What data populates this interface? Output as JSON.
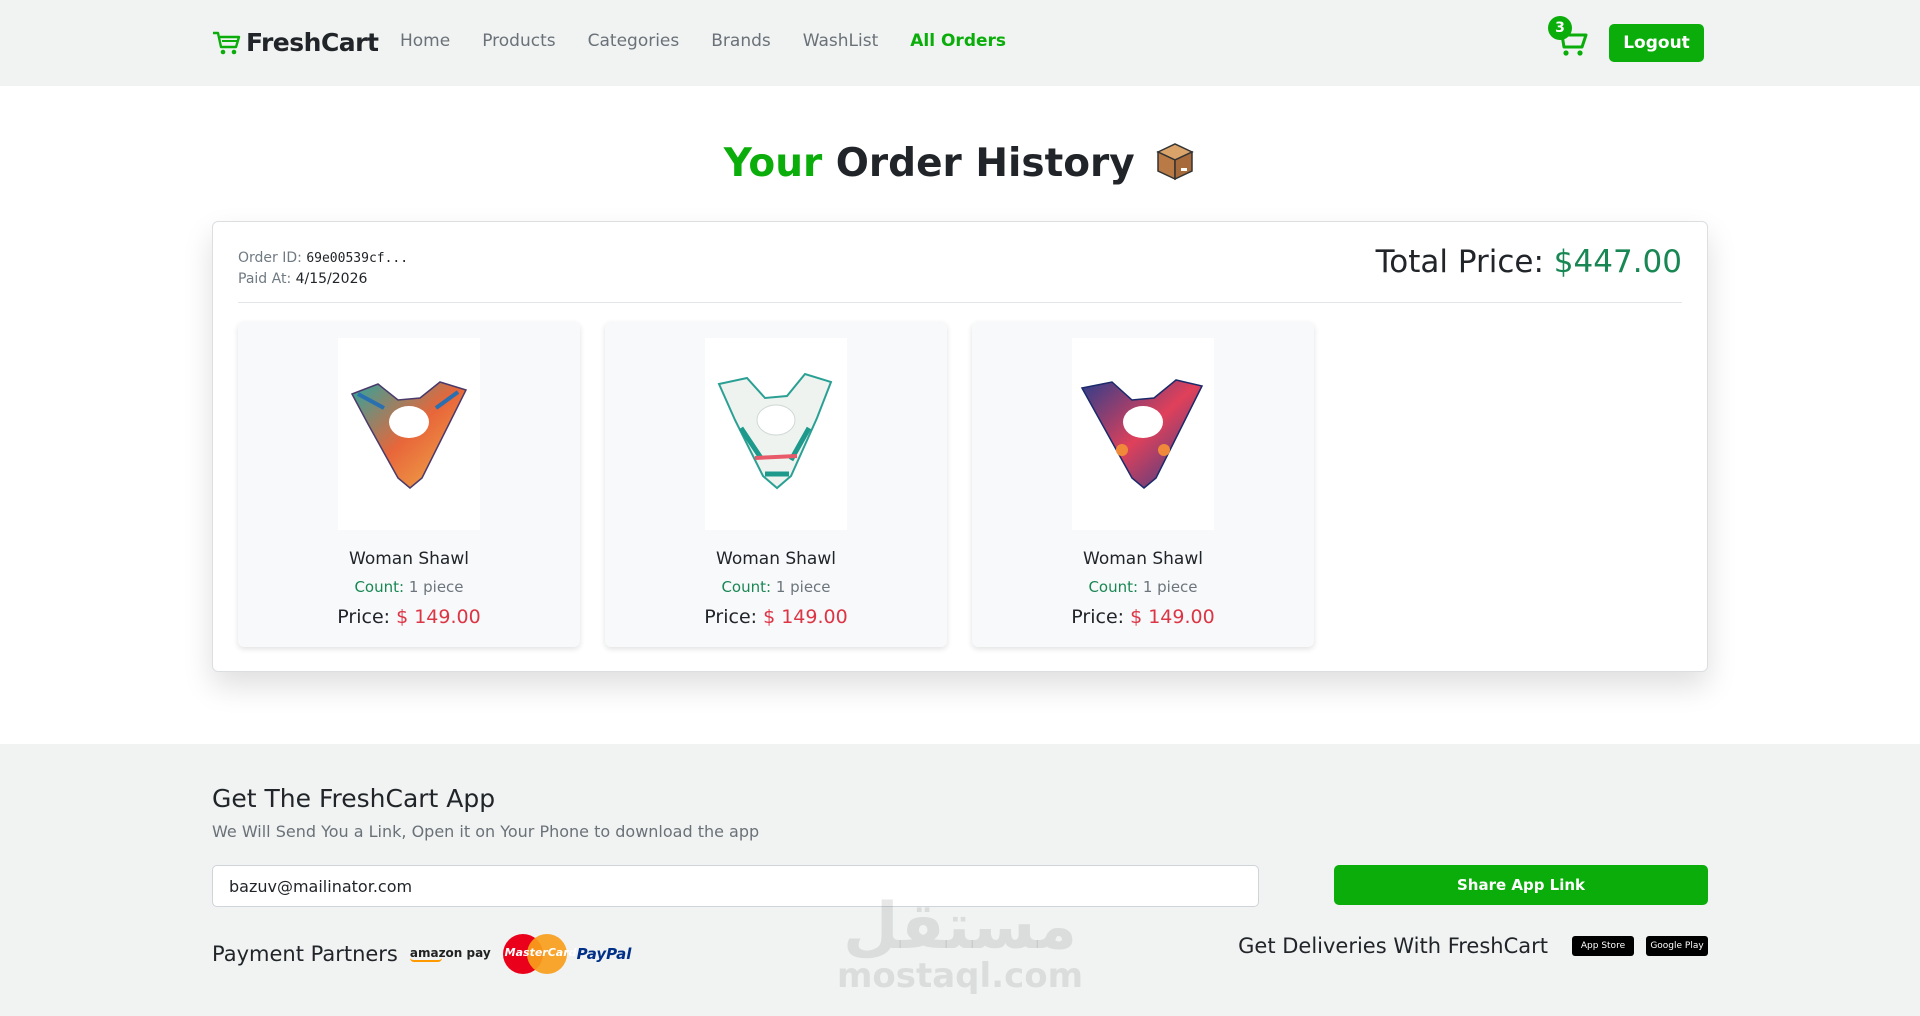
{
  "brand": {
    "name": "FreshCart"
  },
  "nav": {
    "links": [
      "Home",
      "Products",
      "Categories",
      "Brands",
      "WashList",
      "All Orders"
    ],
    "active": "All Orders",
    "cart_count": "3",
    "logout_label": "Logout"
  },
  "page": {
    "title_accent": "Your",
    "title_rest": "Order History"
  },
  "order": {
    "id_label": "Order ID:",
    "id_value": "69e00539cf...",
    "paid_label": "Paid At:",
    "paid_value": "4/15/2026",
    "total_label": "Total Price:",
    "total_value": "$447.00",
    "items": [
      {
        "name": "Woman Shawl",
        "count_label": "Count:",
        "count_value": "1 piece",
        "price_label": "Price:",
        "price_value": "$ 149.00"
      },
      {
        "name": "Woman Shawl",
        "count_label": "Count:",
        "count_value": "1 piece",
        "price_label": "Price:",
        "price_value": "$ 149.00"
      },
      {
        "name": "Woman Shawl",
        "count_label": "Count:",
        "count_value": "1 piece",
        "price_label": "Price:",
        "price_value": "$ 149.00"
      }
    ]
  },
  "footer": {
    "title": "Get The FreshCart App",
    "subtitle": "We Will Send You a Link, Open it on Your Phone to download the app",
    "email_value": "bazuv@mailinator.com",
    "share_label": "Share App Link",
    "payment_label": "Payment Partners",
    "partners": [
      "amazon pay",
      "MasterCard",
      "PayPal"
    ],
    "deliveries_label": "Get Deliveries With FreshCart",
    "stores": [
      "App Store",
      "Google Play"
    ]
  },
  "watermark": {
    "arabic": "مستقل",
    "latin": "mostaql.com"
  },
  "colors": {
    "accent": "#0aad0a",
    "price": "#dc3545",
    "total": "#198754"
  }
}
